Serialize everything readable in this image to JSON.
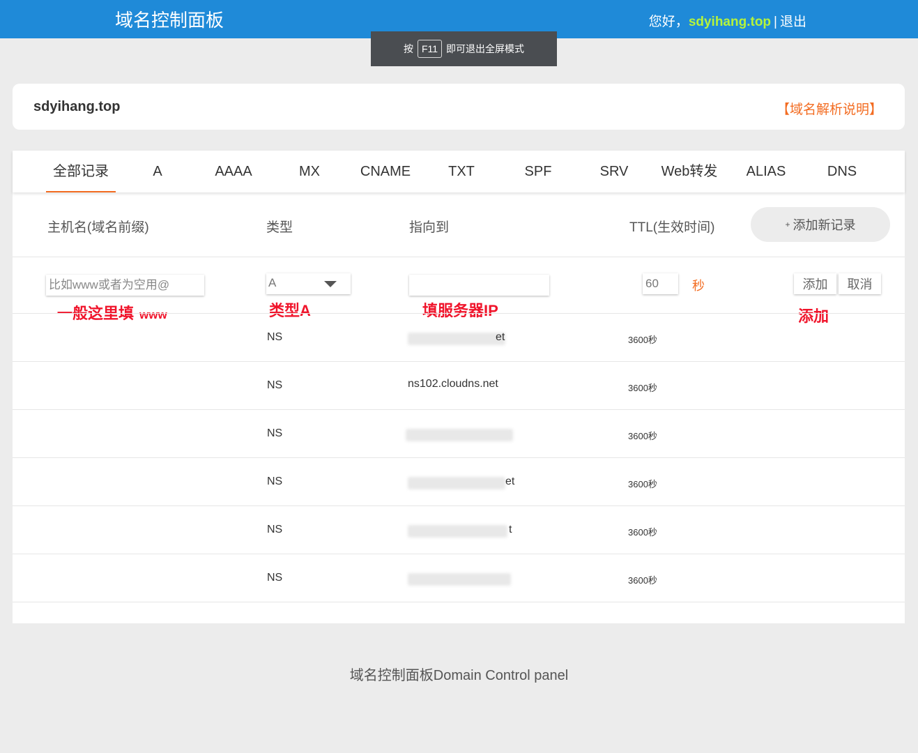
{
  "header": {
    "title": "域名控制面板",
    "greeting_prefix": "您好，",
    "username": "sdyihang.top",
    "separator": "|",
    "logout": "退出"
  },
  "toast": {
    "prefix": "按",
    "key": "F11",
    "suffix": "即可退出全屏模式"
  },
  "domain": {
    "name": "sdyihang.top",
    "help_link": "【域名解析说明】"
  },
  "tabs": [
    {
      "label": "全部记录",
      "active": true
    },
    {
      "label": "A"
    },
    {
      "label": "AAAA"
    },
    {
      "label": "MX"
    },
    {
      "label": "CNAME"
    },
    {
      "label": "TXT"
    },
    {
      "label": "SPF"
    },
    {
      "label": "SRV"
    },
    {
      "label": "Web转发"
    },
    {
      "label": "ALIAS"
    },
    {
      "label": "DNS"
    }
  ],
  "table": {
    "headers": {
      "host": "主机名(域名前缀)",
      "type": "类型",
      "target": "指向到",
      "ttl": "TTL(生效时间)"
    },
    "add_record_plus": "+",
    "add_record_label": "添加新记录"
  },
  "new_record": {
    "host_placeholder": "比如www或者为空用@",
    "type_value": "A",
    "target_value": "",
    "ttl_value": "60",
    "ttl_unit": "秒",
    "add_button": "添加",
    "cancel_button": "取消"
  },
  "annotations": {
    "host_hint": "一般这里填",
    "host_hint_small": "www",
    "type_hint": "类型A",
    "target_hint": "填服务器IP",
    "add_hint": "添加"
  },
  "records": [
    {
      "type": "NS",
      "target_visible": "et",
      "ttl": "3600秒"
    },
    {
      "type": "NS",
      "target_visible": "ns102.cloudns.net",
      "ttl": "3600秒"
    },
    {
      "type": "NS",
      "target_visible": "",
      "ttl": "3600秒"
    },
    {
      "type": "NS",
      "target_visible": "et",
      "ttl": "3600秒"
    },
    {
      "type": "NS",
      "target_visible": "t",
      "ttl": "3600秒"
    },
    {
      "type": "NS",
      "target_visible": "",
      "ttl": "3600秒"
    }
  ],
  "footer": {
    "text": "域名控制面板Domain Control panel"
  },
  "colors": {
    "header_bg": "#1f8ad8",
    "username": "#b6f33a",
    "accent_orange": "#f36c21",
    "annotation_red": "#f0142b",
    "page_bg": "#ececec"
  }
}
